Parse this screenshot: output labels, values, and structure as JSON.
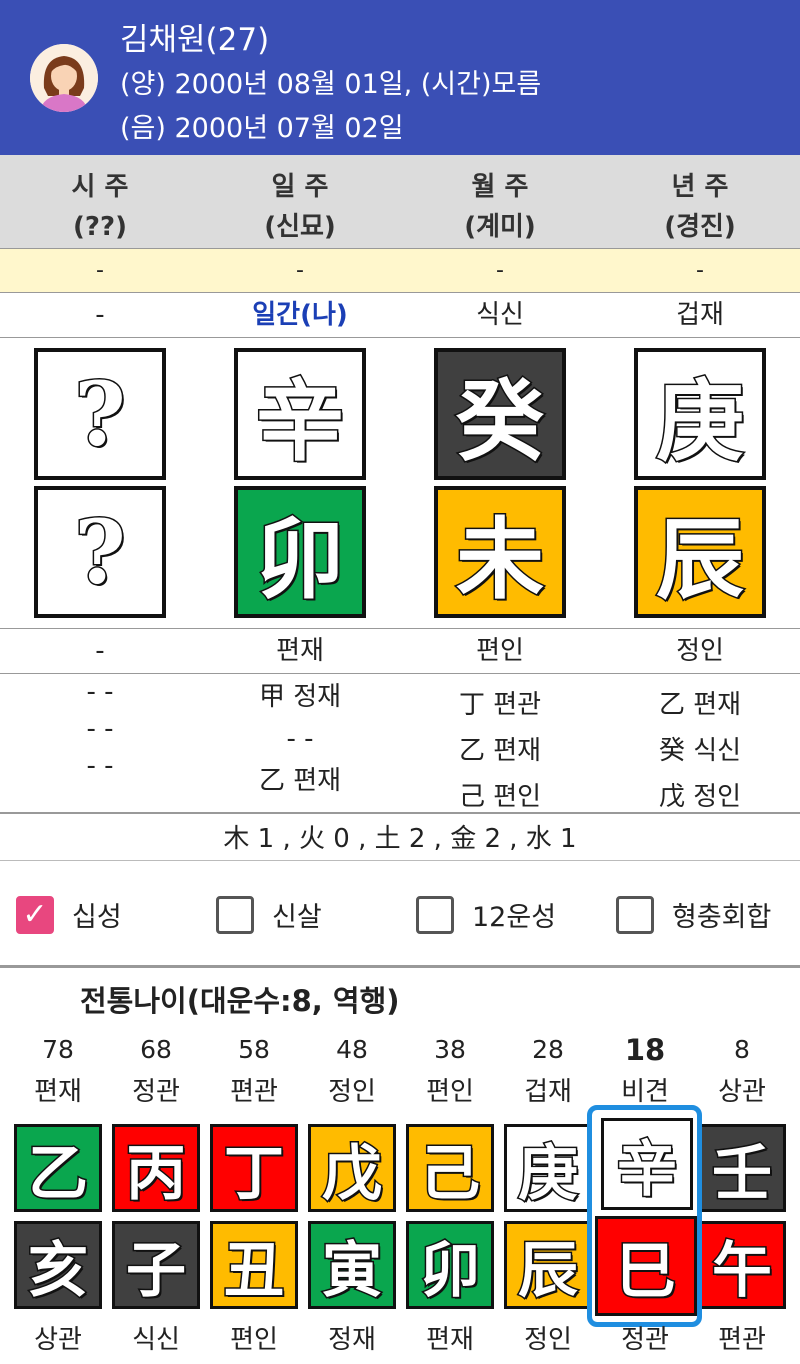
{
  "header": {
    "name": "김채원(27)",
    "solar": "(양) 2000년 08월 01일, (시간)모름",
    "lunar": "(음) 2000년 07월 02일"
  },
  "pillars": [
    {
      "title": "시 주",
      "sub": "(??)",
      "yellow": "-",
      "top_ten": "-",
      "stem": "?",
      "branch": "?",
      "bottom_ten": "-",
      "hidden": [
        "- -",
        "- -",
        "- -"
      ]
    },
    {
      "title": "일 주",
      "sub": "(신묘)",
      "yellow": "-",
      "top_ten": "일간(나)",
      "stem": "辛",
      "branch": "卯",
      "bottom_ten": "편재",
      "hidden": [
        "甲 정재",
        "- -",
        "乙 편재"
      ]
    },
    {
      "title": "월 주",
      "sub": "(계미)",
      "yellow": "-",
      "top_ten": "식신",
      "stem": "癸",
      "branch": "未",
      "bottom_ten": "편인",
      "hidden": [
        "丁 편관",
        "乙 편재",
        "己 편인"
      ]
    },
    {
      "title": "년 주",
      "sub": "(경진)",
      "yellow": "-",
      "top_ten": "겁재",
      "stem": "庚",
      "branch": "辰",
      "bottom_ten": "정인",
      "hidden": [
        "乙 편재",
        "癸 식신",
        "戊 정인"
      ]
    }
  ],
  "elements_line": "木 1 , 火 0 , 土 2 , 金 2 , 水 1",
  "checkboxes": [
    {
      "label": "십성",
      "checked": true
    },
    {
      "label": "신살",
      "checked": false
    },
    {
      "label": "12운성",
      "checked": false
    },
    {
      "label": "형충회합",
      "checked": false
    }
  ],
  "daeun": {
    "title": "전통나이(대운수:8, 역행)",
    "ages": [
      "78",
      "68",
      "58",
      "48",
      "38",
      "28",
      "18",
      "8"
    ],
    "current_index": 6,
    "top_ten": [
      "편재",
      "정관",
      "편관",
      "정인",
      "편인",
      "겁재",
      "비견",
      "상관"
    ],
    "stems": [
      "乙",
      "丙",
      "丁",
      "戊",
      "己",
      "庚",
      "辛",
      "壬"
    ],
    "branches": [
      "亥",
      "子",
      "丑",
      "寅",
      "卯",
      "辰",
      "巳",
      "午"
    ],
    "bottom_ten": [
      "상관",
      "식신",
      "편인",
      "정재",
      "편재",
      "정인",
      "정관",
      "편관"
    ]
  },
  "colors": {
    "header_bg": "#3a4fb5",
    "wood": "#0aa64e",
    "fire": "#ff0000",
    "earth": "#ffbb00",
    "metal": "#ffffff",
    "water": "#404040",
    "unknown": "#ffffff",
    "selection": "#1f8ee0",
    "checkbox_on": "#e8477f"
  }
}
